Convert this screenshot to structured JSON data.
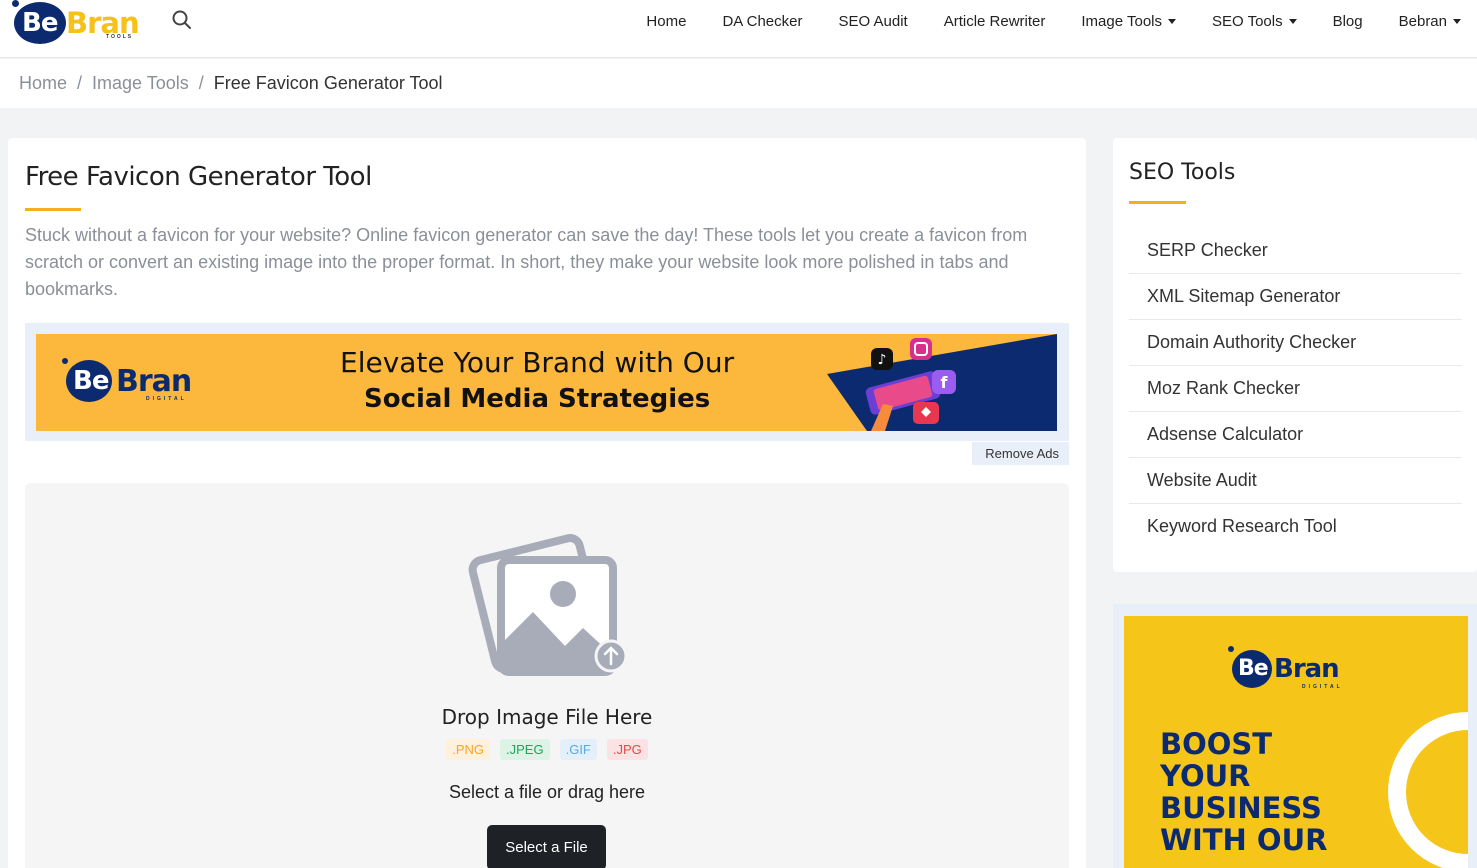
{
  "header": {
    "logo": {
      "be": "Be",
      "bran": "Bran",
      "sub": "TOOLS"
    },
    "nav": [
      {
        "label": "Home"
      },
      {
        "label": "DA Checker"
      },
      {
        "label": "SEO Audit"
      },
      {
        "label": "Article Rewriter"
      },
      {
        "label": "Image Tools",
        "dropdown": true
      },
      {
        "label": "SEO Tools",
        "dropdown": true
      },
      {
        "label": "Blog"
      },
      {
        "label": "Bebran",
        "dropdown": true
      }
    ]
  },
  "breadcrumb": {
    "items": [
      "Home",
      "Image Tools"
    ],
    "current": "Free Favicon Generator Tool",
    "separator": "/"
  },
  "main": {
    "title": "Free Favicon Generator Tool",
    "intro": "Stuck without a favicon for your website? Online favicon generator can save the day! These tools let you create a favicon from scratch or convert an existing image into the proper format. In short, they make your website look more polished in tabs and bookmarks.",
    "ad": {
      "logo_be": "Be",
      "logo_bran": "Bran",
      "logo_sub": "DIGITAL",
      "line1": "Elevate Your Brand with Our",
      "line2": "Social Media Strategies",
      "remove_ads": "Remove Ads"
    },
    "upload": {
      "title": "Drop Image File Here",
      "extensions": [
        {
          "label": ".PNG",
          "color": "#f5a623",
          "bg": "#fdf1de"
        },
        {
          "label": ".JPEG",
          "color": "#1aa560",
          "bg": "#dcf3e6"
        },
        {
          "label": ".GIF",
          "color": "#5aa8e6",
          "bg": "#e3eff9"
        },
        {
          "label": ".JPG",
          "color": "#e5484d",
          "bg": "#fbe3e4"
        }
      ],
      "subtitle": "Select a file or drag here",
      "button": "Select a File"
    }
  },
  "sidebar": {
    "title": "SEO Tools",
    "items": [
      {
        "label": "SERP Checker"
      },
      {
        "label": "XML Sitemap Generator"
      },
      {
        "label": "Domain Authority Checker"
      },
      {
        "label": "Moz Rank Checker"
      },
      {
        "label": "Adsense Calculator"
      },
      {
        "label": "Website Audit"
      },
      {
        "label": "Keyword Research Tool"
      }
    ],
    "ad": {
      "logo_be": "Be",
      "logo_bran": "Bran",
      "logo_sub": "DIGITAL",
      "lines": [
        "BOOST",
        "YOUR",
        "BUSINESS",
        "WITH OUR"
      ]
    }
  },
  "colors": {
    "accent": "#f2b01e",
    "brand_navy": "#0b2a6f",
    "brand_yellow": "#f6c21a"
  }
}
